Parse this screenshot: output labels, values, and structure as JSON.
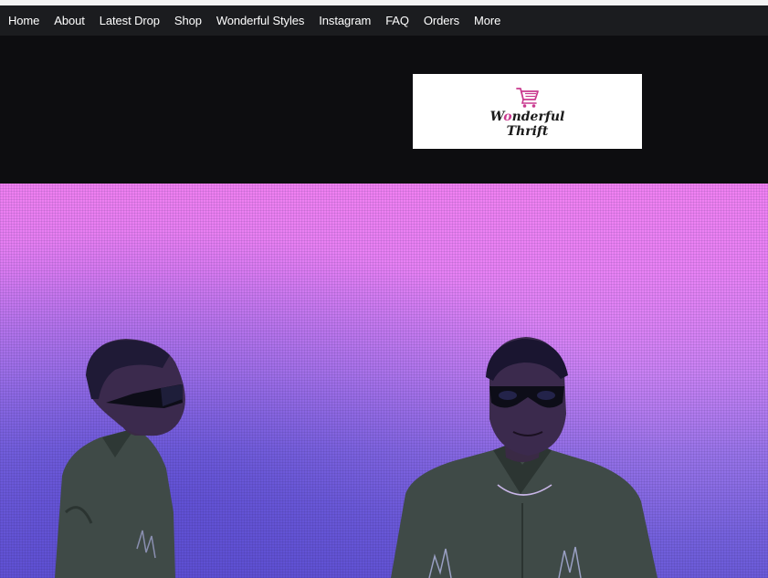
{
  "nav": {
    "items": [
      {
        "label": "Home"
      },
      {
        "label": "About"
      },
      {
        "label": "Latest Drop"
      },
      {
        "label": "Shop"
      },
      {
        "label": "Wonderful Styles"
      },
      {
        "label": "Instagram"
      },
      {
        "label": "FAQ"
      },
      {
        "label": "Orders"
      },
      {
        "label": "More"
      }
    ]
  },
  "logo": {
    "line1_pre": "W",
    "line1_accent": "o",
    "line1_post": "nderful",
    "line2": "Thrift",
    "icon": "shopping-cart-icon",
    "accent_color": "#c93a8f"
  },
  "hero": {
    "gradient_top": "#f07ff0",
    "gradient_bottom": "#6a5ad8"
  }
}
